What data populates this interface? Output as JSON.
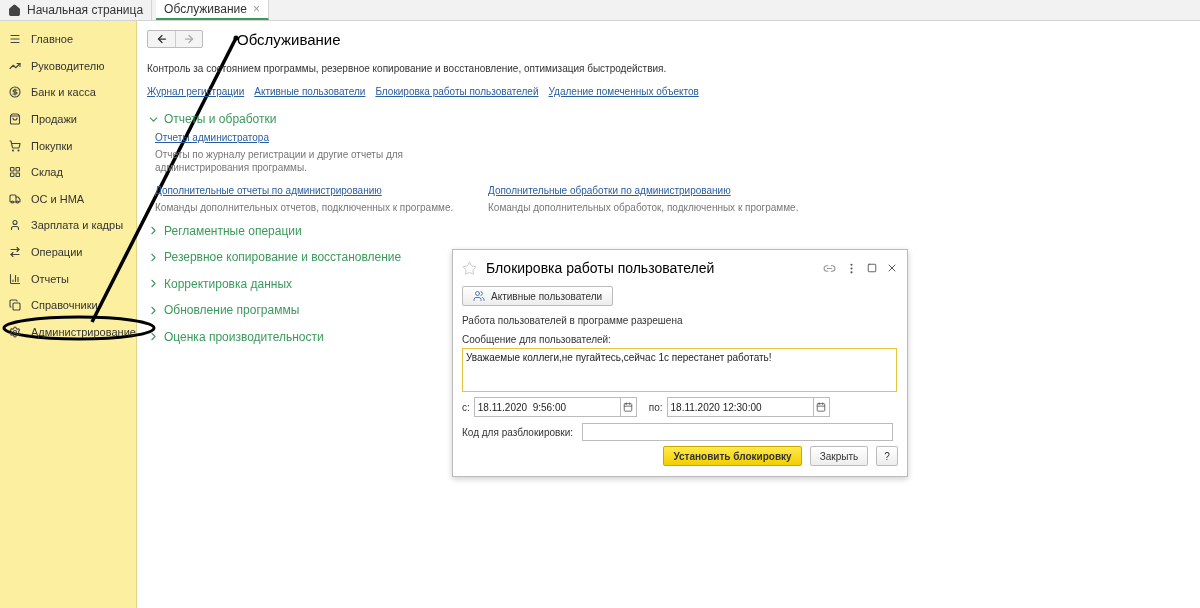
{
  "tabs": [
    {
      "label": "Начальная страница",
      "kind": "home",
      "selected": false,
      "closable": false
    },
    {
      "label": "Обслуживание",
      "kind": "page",
      "selected": true,
      "closable": true
    }
  ],
  "close_glyph": "×",
  "sidebar": {
    "items": [
      {
        "label": "Главное"
      },
      {
        "label": "Руководителю"
      },
      {
        "label": "Банк и касса"
      },
      {
        "label": "Продажи"
      },
      {
        "label": "Покупки"
      },
      {
        "label": "Склад"
      },
      {
        "label": "ОС и НМА"
      },
      {
        "label": "Зарплата и кадры"
      },
      {
        "label": "Операции"
      },
      {
        "label": "Отчеты"
      },
      {
        "label": "Справочники"
      },
      {
        "label": "Администрирование"
      }
    ]
  },
  "page": {
    "title": "Обслуживание",
    "description": "Контроль за состоянием программы, резервное копирование и восстановление, оптимизация быстродействия.",
    "links": [
      "Журнал регистрации",
      "Активные пользователи",
      "Блокировка работы пользователей",
      "Удаление помеченных объектов"
    ],
    "sections": [
      {
        "title": "Отчеты и обработки",
        "expanded": true,
        "children": [
          {
            "link": "Отчеты администратора",
            "text": "Отчеты по журналу регистрации и другие отчеты для администрирования программы."
          },
          {
            "link": "Дополнительные отчеты по администрированию",
            "text": "Команды дополнительных отчетов, подключенных к программе."
          },
          {
            "link": "Дополнительные обработки по администрированию",
            "text": "Команды дополнительных обработок, подключенных к программе."
          }
        ]
      },
      {
        "title": "Регламентные операции",
        "expanded": false
      },
      {
        "title": "Резервное копирование и восстановление",
        "expanded": false
      },
      {
        "title": "Корректировка данных",
        "expanded": false
      },
      {
        "title": "Обновление программы",
        "expanded": false
      },
      {
        "title": "Оценка производительности",
        "expanded": false
      }
    ]
  },
  "dialog": {
    "title": "Блокировка работы пользователей",
    "users_button": "Активные пользователи",
    "status": "Работа пользователей в программе разрешена",
    "message_label": "Сообщение для пользователей:",
    "message": "Уважаемые коллеги,не пугайтесь,сейчас 1с перестанет работать!",
    "from_label": "с:",
    "from": "18.11.2020  9:56:00",
    "to_label": "по:",
    "to": "18.11.2020 12:30:00",
    "code_label": "Код для разблокировки:",
    "buttons": [
      {
        "label": "Установить блокировку",
        "kind": "primary"
      },
      {
        "label": "Закрыть",
        "kind": "normal"
      },
      {
        "label": "?",
        "kind": "help"
      }
    ]
  }
}
